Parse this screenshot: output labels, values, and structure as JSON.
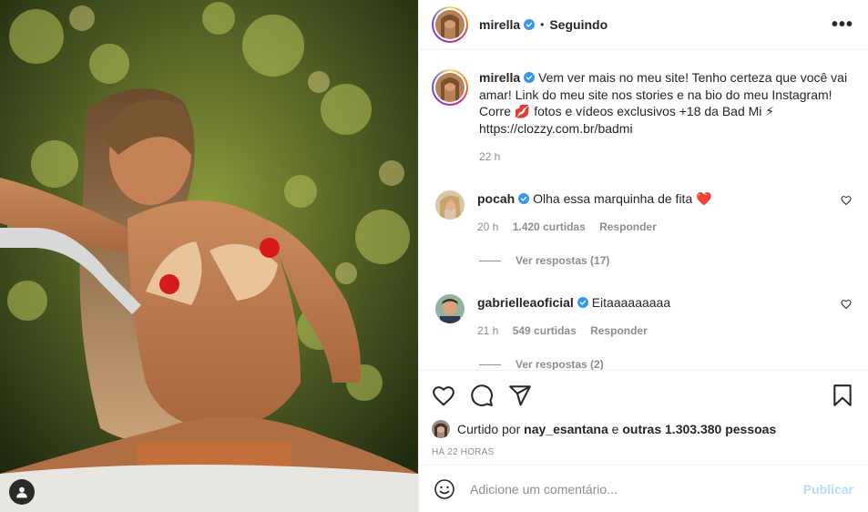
{
  "post": {
    "author": "mirella",
    "follow_status": "Seguindo",
    "more_label": "•••",
    "separator": "•"
  },
  "caption": {
    "username": "mirella",
    "text_line1": "Vem ver mais no meu site! Tenho certeza que você vai amar! Link do meu site nos stories e na bio do meu Instagram! Corre 💋 fotos e vídeos exclusivos +18 da Bad Mi ⚡",
    "link": "https://clozzy.com.br/badmi",
    "time": "22 h"
  },
  "comments": [
    {
      "username": "pocah",
      "text": "Olha essa marquinha de fita ❤️",
      "time": "20 h",
      "likes": "1.420 curtidas",
      "reply": "Responder",
      "view_replies": "Ver respostas (17)"
    },
    {
      "username": "gabrielleaoficial",
      "text": "Eitaaaaaaaaa",
      "time": "21 h",
      "likes": "549 curtidas",
      "reply": "Responder",
      "view_replies": "Ver respostas (2)"
    }
  ],
  "likes": {
    "prefix": "Curtido por",
    "first_user": "nay_esantana",
    "middle": "e",
    "others": "outras 1.303.380 pessoas"
  },
  "timestamp": "HÁ 22 HORAS",
  "add_comment": {
    "placeholder": "Adicione um comentário...",
    "publish": "Publicar"
  },
  "icons": {
    "verified": "verified-badge-icon",
    "like": "heart-icon",
    "comment": "comment-icon",
    "share": "share-icon",
    "save": "bookmark-icon",
    "emoji": "emoji-icon",
    "user_tag": "user-tag-icon"
  },
  "colors": {
    "verified": "#3897f0",
    "publish_disabled": "#b2dffc",
    "secondary_text": "#8e8e8e",
    "heart_red": "#ed4956"
  }
}
